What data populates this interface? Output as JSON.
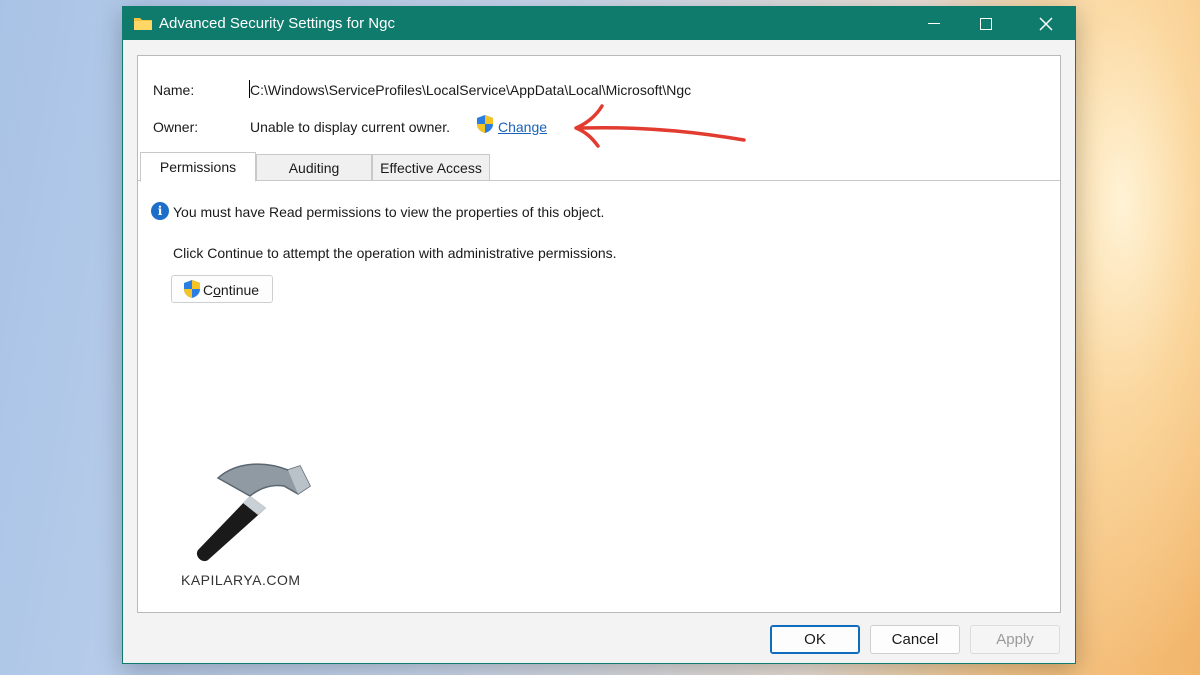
{
  "window": {
    "title": "Advanced Security Settings for Ngc",
    "accent_color": "#0f7b6c",
    "icons": [
      "folder-icon",
      "minimize-icon",
      "maximize-icon",
      "close-icon"
    ]
  },
  "details": {
    "name_label": "Name:",
    "name_value": "C:\\Windows\\ServiceProfiles\\LocalService\\AppData\\Local\\Microsoft\\Ngc",
    "owner_label": "Owner:",
    "owner_value": "Unable to display current owner.",
    "change_link": "Change"
  },
  "tabs": [
    {
      "label": "Permissions",
      "active": true
    },
    {
      "label": "Auditing",
      "active": false
    },
    {
      "label": "Effective Access",
      "active": false
    }
  ],
  "permissions": {
    "info_message": "You must have Read permissions to view the properties of this object.",
    "hint_message": "Click Continue to attempt the operation with administrative permissions.",
    "continue_first": "C",
    "continue_underlined": "o",
    "continue_rest": "ntinue"
  },
  "watermark": "KAPILARYA.COM",
  "footer": {
    "ok": "OK",
    "cancel": "Cancel",
    "apply": "Apply",
    "apply_enabled": false
  }
}
